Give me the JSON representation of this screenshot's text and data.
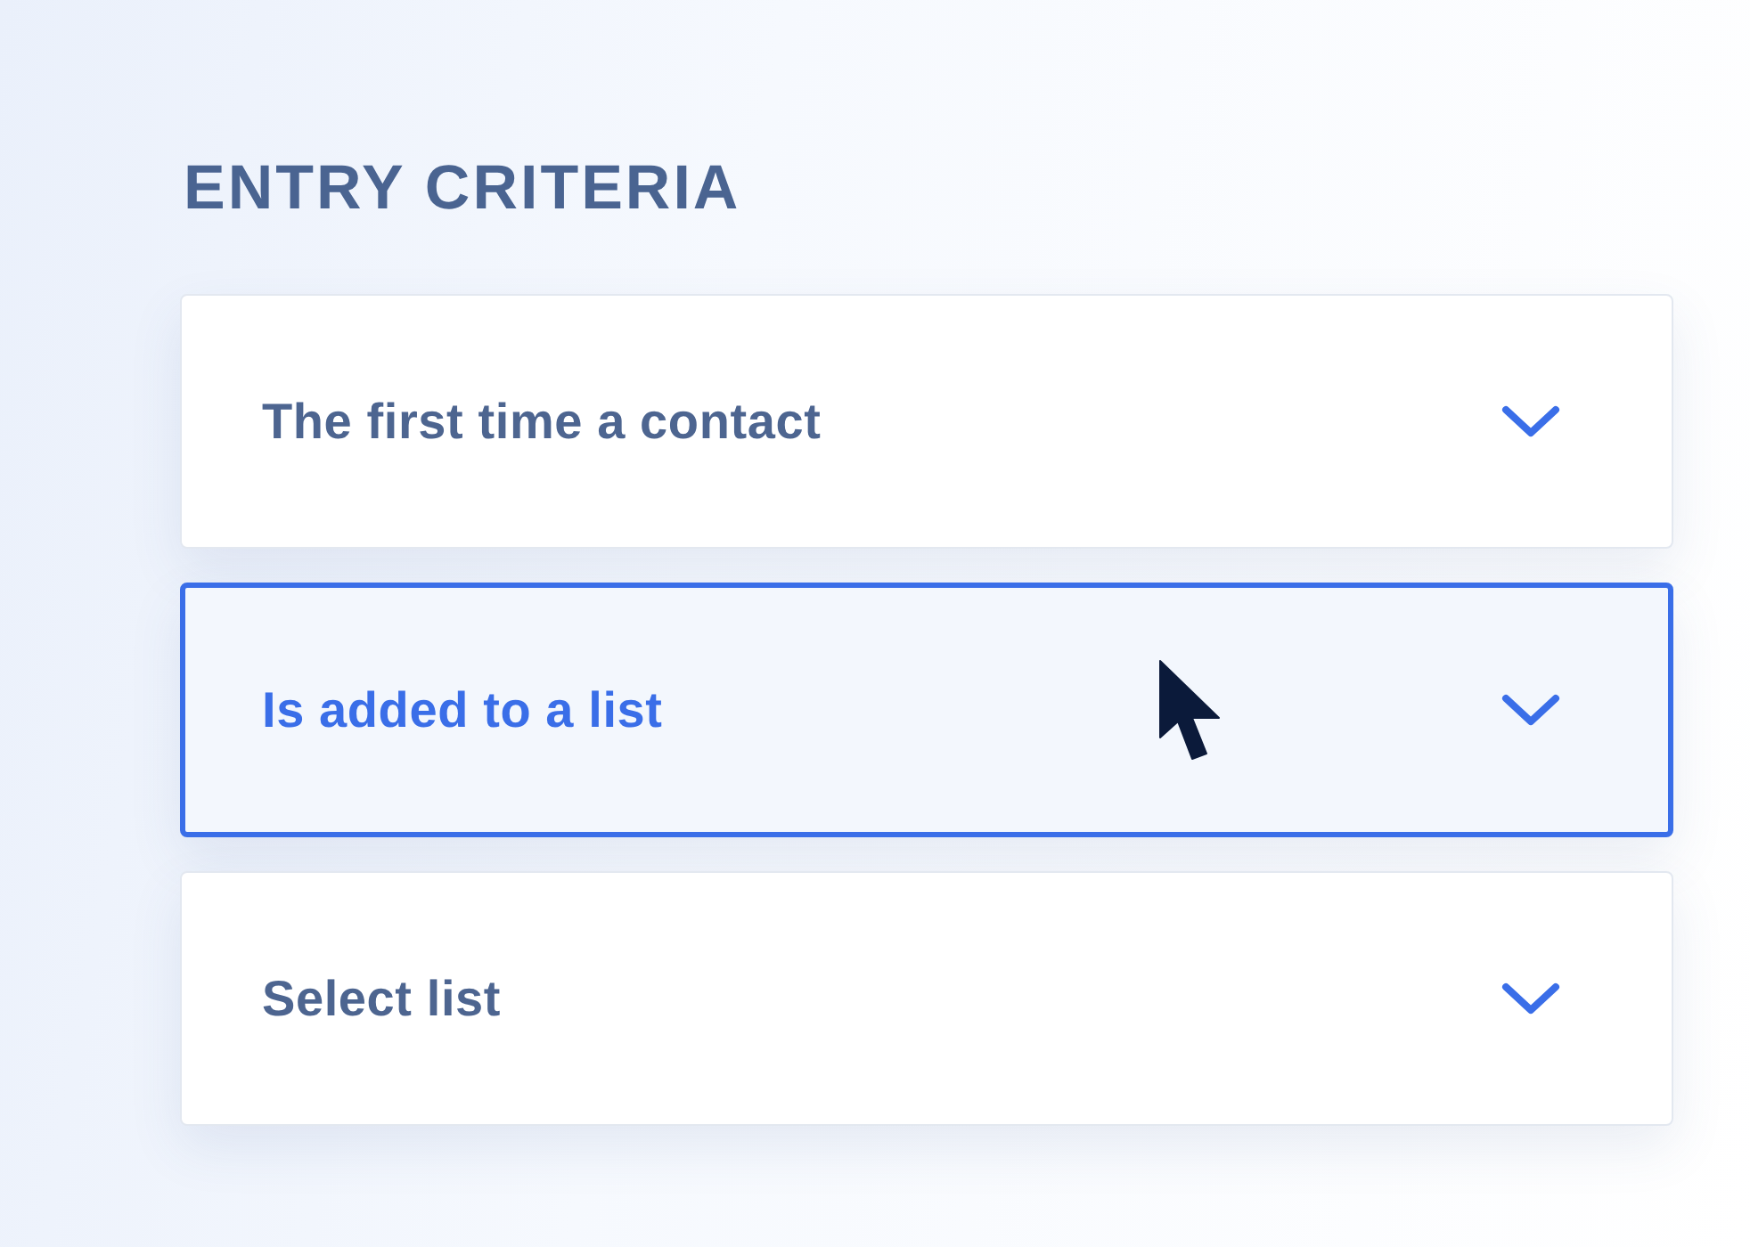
{
  "title": "ENTRY CRITERIA",
  "dropdowns": [
    {
      "label": "The first time a contact",
      "selected": false
    },
    {
      "label": "Is added to a list",
      "selected": true
    },
    {
      "label": "Select list",
      "selected": false
    }
  ]
}
